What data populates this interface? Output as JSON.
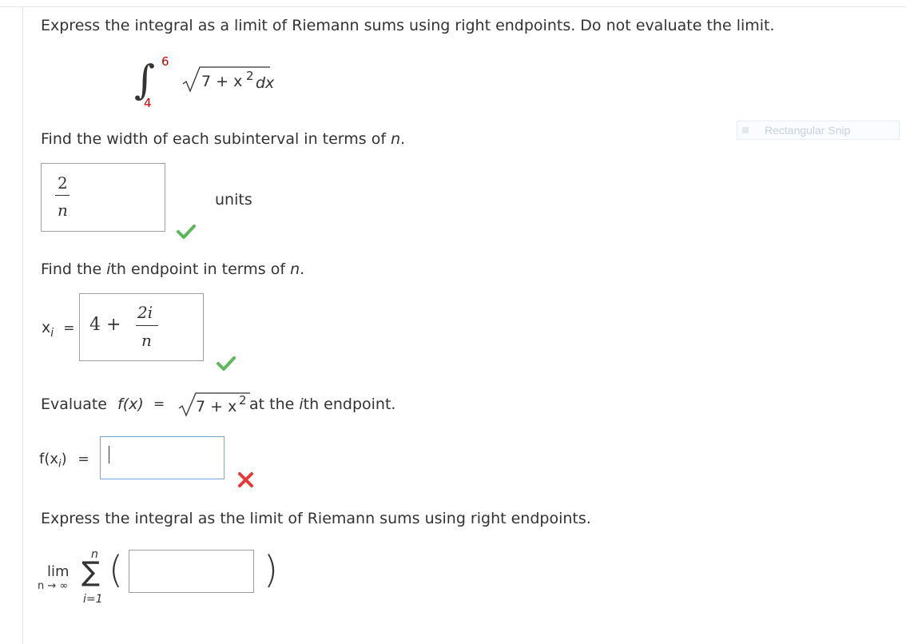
{
  "question": {
    "prompt": "Express the integral as a limit of Riemann sums using right endpoints. Do not evaluate the limit.",
    "integral": {
      "symbol": "∫",
      "upper": "6",
      "lower": "4",
      "integrand": "7 + x",
      "exponent": "2",
      "differential": "dx"
    }
  },
  "step1": {
    "prompt_text": "Find the width of each subinterval in terms of ",
    "prompt_var": "n",
    "prompt_end": ".",
    "answer_num": "2",
    "answer_den": "n",
    "unit_label": "units",
    "status": "correct"
  },
  "step2": {
    "prompt_a": "Find the ",
    "prompt_var_i": "i",
    "prompt_b": "th endpoint in terms of ",
    "prompt_var_n": "n",
    "prompt_end": ".",
    "lhs_x": "x",
    "lhs_sub": "i",
    "eq": "=",
    "answer_whole": "4 +",
    "answer_num": "2i",
    "answer_den": "n",
    "status": "correct"
  },
  "step3": {
    "prompt_a": "Evaluate ",
    "prompt_fx": "f(x)",
    "prompt_eq": "=",
    "prompt_expr": "7 + x",
    "prompt_exp": "2",
    "prompt_b": " at the ",
    "prompt_var_i": "i",
    "prompt_c": "th endpoint.",
    "lhs_f": "f(x",
    "lhs_sub": "i",
    "lhs_close": ")",
    "eq": "=",
    "answer_value": "",
    "status": "incorrect"
  },
  "step4": {
    "prompt": "Express the integral as the limit of Riemann sums using right endpoints.",
    "lim": "lim",
    "lim_sub": "n → ∞",
    "sigma": "∑",
    "sigma_top": "n",
    "sigma_bottom": "i=1",
    "open_paren": "(",
    "close_paren": ")",
    "answer_value": ""
  },
  "overlay": {
    "label": "Rectangular Snip"
  },
  "colors": {
    "correct": "#5cb85c",
    "incorrect": "#e53935",
    "limit_red": "#cc0000"
  }
}
